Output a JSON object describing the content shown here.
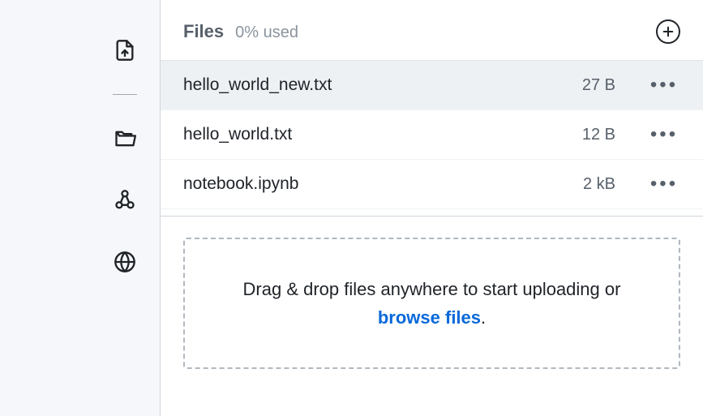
{
  "sidebar": {
    "icons": [
      {
        "name": "upload-file-icon"
      },
      {
        "name": "folder-open-icon"
      },
      {
        "name": "share-nodes-icon"
      },
      {
        "name": "globe-icon"
      }
    ]
  },
  "header": {
    "title": "Files",
    "usage": "0% used"
  },
  "files": [
    {
      "name": "hello_world_new.txt",
      "size": "27 B",
      "selected": true
    },
    {
      "name": "hello_world.txt",
      "size": "12 B",
      "selected": false
    },
    {
      "name": "notebook.ipynb",
      "size": "2 kB",
      "selected": false
    }
  ],
  "dropzone": {
    "text_before": "Drag & drop files anywhere to start uploading or ",
    "browse_label": "browse files",
    "text_after": "."
  }
}
